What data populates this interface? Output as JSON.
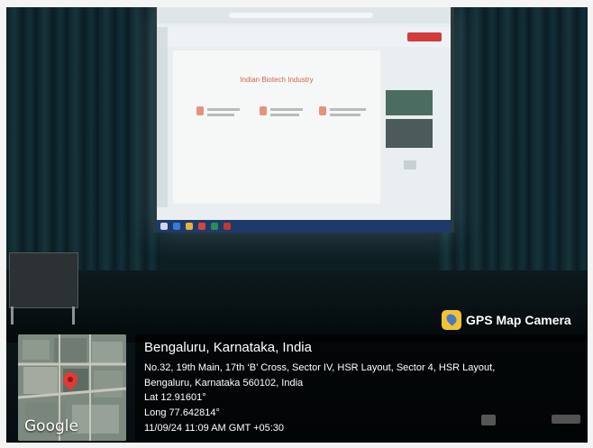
{
  "slide": {
    "title": "Indian Biotech Industry"
  },
  "watermark": {
    "app_name": "GPS Map Camera"
  },
  "map": {
    "provider": "Google"
  },
  "location": {
    "city_line": "Bengaluru, Karnataka, India",
    "address_line1": "No.32, 19th Main, 17th ‘B’ Cross, Sector IV, HSR Layout, Sector 4, HSR Layout,",
    "address_line2": "Bengaluru, Karnataka 560102, India",
    "lat": "Lat 12.91601°",
    "long": "Long 77.642814°",
    "datetime": "11/09/24 11:09 AM GMT +05:30"
  },
  "colors": {
    "pin": "#e53935",
    "brand_icon": "#f2c430",
    "leave_button": "#d23c3c"
  }
}
